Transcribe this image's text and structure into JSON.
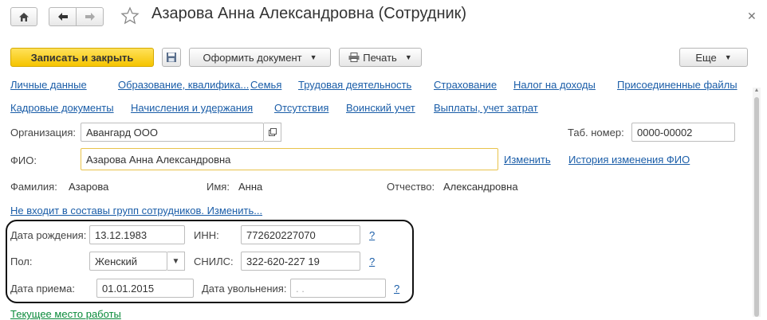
{
  "window": {
    "title": "Азарова Анна Александровна (Сотрудник)"
  },
  "toolbar": {
    "save_close": "Записать и закрыть",
    "create_document": "Оформить документ",
    "print": "Печать",
    "more": "Еще"
  },
  "nav_links": {
    "row1": [
      "Личные данные",
      "Образование, квалифика...",
      "Семья",
      "Трудовая деятельность",
      "Страхование",
      "Налог на доходы",
      "Присоединенные файлы"
    ],
    "row2": [
      "Кадровые документы",
      "Начисления и удержания",
      "Отсутствия",
      "Воинский учет",
      "Выплаты, учет затрат"
    ]
  },
  "organization": {
    "label": "Организация:",
    "value": "Авангард ООО"
  },
  "tab_number": {
    "label": "Таб. номер:",
    "value": "0000-00002"
  },
  "fio": {
    "label": "ФИО:",
    "value": "Азарова Анна Александровна",
    "change_link": "Изменить",
    "history_link": "История изменения ФИО"
  },
  "name_parts": {
    "surname_label": "Фамилия:",
    "surname": "Азарова",
    "name_label": "Имя:",
    "name": "Анна",
    "patronymic_label": "Отчество:",
    "patronymic": "Александровна"
  },
  "groups_link": "Не входит в составы групп сотрудников. Изменить...",
  "birth_date": {
    "label": "Дата рождения:",
    "value": "13.12.1983"
  },
  "inn": {
    "label": "ИНН:",
    "value": "772620227070",
    "help": "?"
  },
  "gender": {
    "label": "Пол:",
    "value": "Женский"
  },
  "snils": {
    "label": "СНИЛС:",
    "value": "322-620-227 19",
    "help": "?"
  },
  "hire_date": {
    "label": "Дата приема:",
    "value": "01.01.2015"
  },
  "dismissal_date": {
    "label": "Дата увольнения:",
    "value": ". .",
    "help": "?"
  },
  "current_workplace_link": "Текущее место работы"
}
